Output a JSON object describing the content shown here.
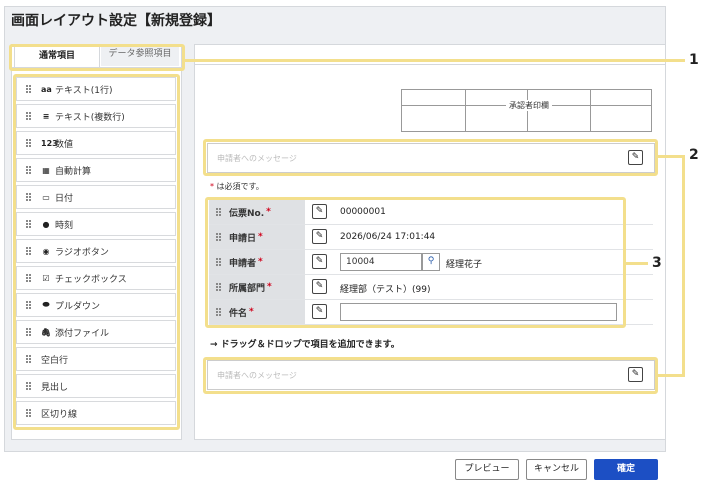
{
  "page_title": "画面レイアウト設定【新規登録】",
  "tabs": [
    "通常項目",
    "データ参照項目"
  ],
  "palette_items": [
    {
      "icon": "aa",
      "icon_name": "text-single-icon",
      "label": "テキスト(1行)"
    },
    {
      "icon": "≡",
      "icon_name": "text-multi-icon",
      "label": "テキスト(複数行)"
    },
    {
      "icon": "123",
      "icon_name": "number-icon",
      "label": "数値"
    },
    {
      "icon": "▦",
      "icon_name": "calculator-icon",
      "label": "自動計算"
    },
    {
      "icon": "▭",
      "icon_name": "calendar-icon",
      "label": "日付"
    },
    {
      "icon": "●",
      "icon_name": "clock-icon",
      "label": "時刻"
    },
    {
      "icon": "◉",
      "icon_name": "radio-button-icon",
      "label": "ラジオボタン"
    },
    {
      "icon": "☑",
      "icon_name": "checkbox-icon",
      "label": "チェックボックス"
    },
    {
      "icon": "⬬",
      "icon_name": "dropdown-icon",
      "label": "プルダウン"
    },
    {
      "icon": "🖇",
      "icon_name": "paperclip-icon",
      "label": "添付ファイル"
    },
    {
      "icon": "",
      "icon_name": "",
      "label": "空白行"
    },
    {
      "icon": "",
      "icon_name": "",
      "label": "見出し"
    },
    {
      "icon": "",
      "icon_name": "",
      "label": "区切り線"
    }
  ],
  "stamp_label": "承認者印欄",
  "message_placeholder": "申請者へのメッセージ",
  "required_note": "は必須です。",
  "required_mark": "*",
  "form_rows": [
    {
      "label": "伝票No.",
      "value": "00000001"
    },
    {
      "label": "申請日",
      "value": "2026/06/24 17:01:44"
    },
    {
      "label": "申請者",
      "input_value": "10004",
      "value": "経理花子"
    },
    {
      "label": "所属部門",
      "value": "経理部（テスト）(99)"
    },
    {
      "label": "件名",
      "input_value": ""
    }
  ],
  "dnd_hint": "→ ドラッグ＆ドロップで項目を追加できます。",
  "callouts": [
    "1",
    "2",
    "3"
  ],
  "buttons": {
    "preview": "プレビュー",
    "cancel": "キャンセル",
    "confirm": "確定"
  },
  "colors": {
    "highlight": "#f3df8c",
    "primary": "#1c4fc4",
    "required": "#d0021b"
  }
}
